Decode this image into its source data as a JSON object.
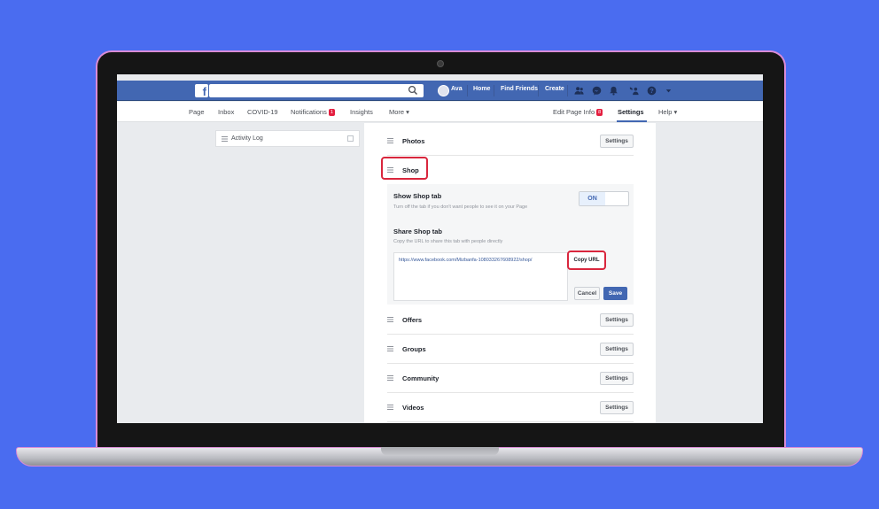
{
  "topbar": {
    "search_placeholder": "",
    "user_name": "Ava",
    "links": [
      "Home",
      "Find Friends",
      "Create"
    ]
  },
  "pagebar": {
    "left_tabs": [
      "Page",
      "Inbox",
      "COVID-19",
      "Notifications",
      "Insights",
      "More ▾"
    ],
    "notifications_badge": "1",
    "edit_page_info": "Edit Page Info",
    "edit_badge": "8",
    "settings": "Settings",
    "help": "Help ▾"
  },
  "sidebar": {
    "activity_log": "Activity Log"
  },
  "panel": {
    "rows": [
      {
        "title": "Photos",
        "button": "Settings"
      },
      {
        "title": "Shop"
      },
      {
        "title": "Offers",
        "button": "Settings"
      },
      {
        "title": "Groups",
        "button": "Settings"
      },
      {
        "title": "Community",
        "button": "Settings"
      },
      {
        "title": "Videos",
        "button": "Settings"
      }
    ],
    "shop": {
      "show_title": "Show Shop tab",
      "show_sub": "Turn off the tab if you don't want people to see it on your Page",
      "toggle": "ON",
      "share_title": "Share Shop tab",
      "share_sub": "Copy the URL to share this tab with people directly",
      "url": "https://www.facebook.com/Mizbanfa-108033267608922/shop/",
      "copy_button": "Copy URL",
      "cancel_button": "Cancel",
      "save_button": "Save"
    }
  },
  "colors": {
    "background": "#4a6cf0",
    "fb_blue": "#4267b2",
    "highlight_red": "#d9263d"
  }
}
